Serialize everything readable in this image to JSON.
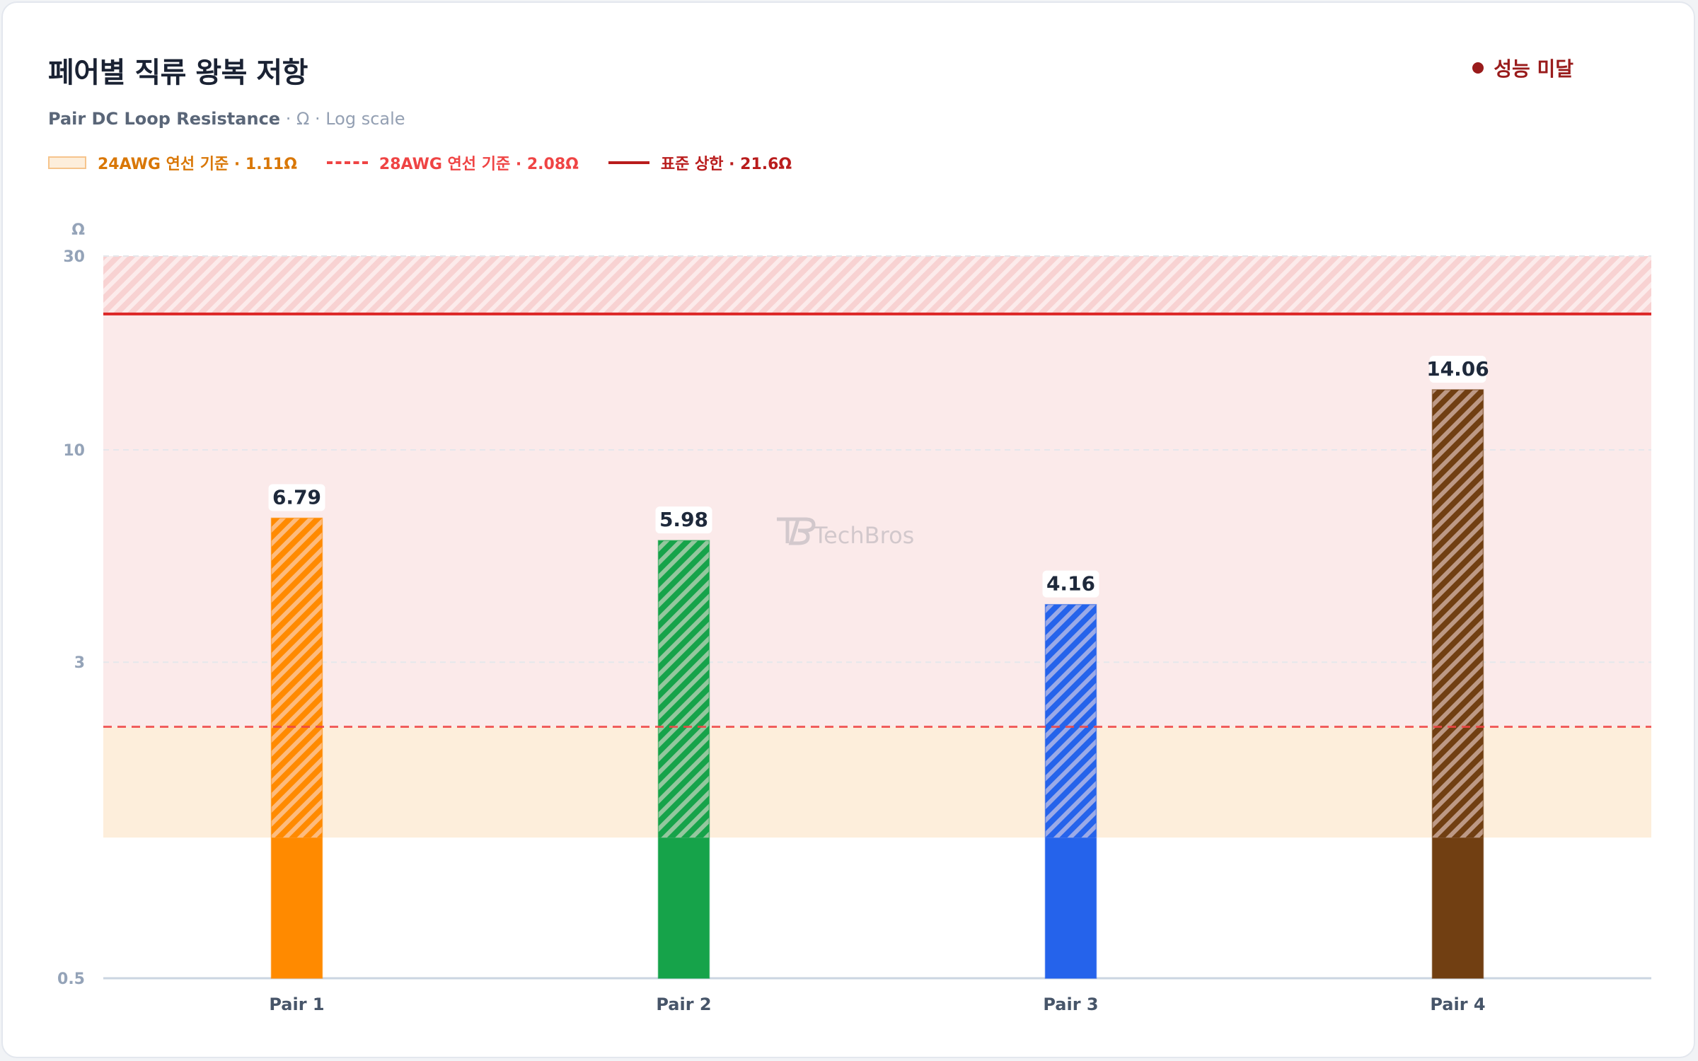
{
  "header": {
    "title": "페어별 직류 왕복 저항",
    "subtitle_main": "Pair DC Loop Resistance",
    "subtitle_rest": "· Ω · Log scale",
    "status_label": "성능 미달",
    "status_color": "#991b1b"
  },
  "legend": {
    "awg24": "24AWG 연선 기준 · 1.11Ω",
    "awg28": "28AWG 연선 기준 · 2.08Ω",
    "standard": "표준 상한 · 21.6Ω"
  },
  "watermark": "TechBros",
  "chart_data": {
    "type": "bar",
    "title": "페어별 직류 왕복 저항",
    "subtitle": "Pair DC Loop Resistance · Ω · Log scale",
    "ylabel": "Ω",
    "yscale": "log",
    "ylim": [
      0.5,
      30
    ],
    "yticks": [
      0.5,
      3,
      10,
      30
    ],
    "grid": true,
    "categories": [
      "Pair 1",
      "Pair 2",
      "Pair 3",
      "Pair 4"
    ],
    "values": [
      6.79,
      5.98,
      4.16,
      14.06
    ],
    "value_labels": [
      "6.79",
      "5.98",
      "4.16",
      "14.06"
    ],
    "colors": [
      "#ff8a00",
      "#16a34a",
      "#2563eb",
      "#713f12"
    ],
    "reference_lines": [
      {
        "label": "24AWG 연선 기준 · 1.11Ω",
        "value": 1.11,
        "style": "band",
        "color": "#f6c48c"
      },
      {
        "label": "28AWG 연선 기준 · 2.08Ω",
        "value": 2.08,
        "style": "dashed",
        "color": "#ef4444"
      },
      {
        "label": "표준 상한 · 21.6Ω",
        "value": 21.6,
        "style": "solid",
        "color": "#dc2626"
      }
    ],
    "legend_position": "top-left"
  }
}
